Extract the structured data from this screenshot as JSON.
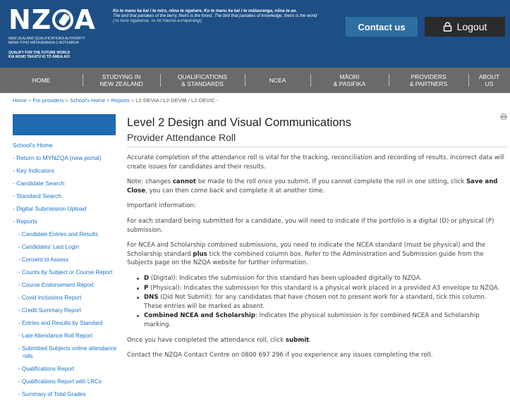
{
  "header": {
    "logo_text_pre": "NZ",
    "logo_text_post": "A",
    "logo_sub_1": "NEW ZEALAND QUALIFICATIONS AUTHORITY",
    "logo_sub_2": "MANA TOHU MĀTAURANGA O AOTEAROA",
    "logo_tag_1": "QUALIFY FOR THE FUTURE WORLD",
    "logo_tag_2": "KIA NOHO TAKATŪ KI TŌ ĀMUA AO!",
    "motto_line1": "Ko te manu ka kai i te miro, nōna te ngahere. Ko te manu ka kai i te mātauranga, nōna te ao.",
    "motto_line2": "The bird that partakes of the berry, theirs is the forest. The bird that partakes of knowledge, theirs is the world",
    "motto_line3": "(Te Kere Ngatierua, Te Ati Haunui-a-Pāpārangi)",
    "contact_label": "Contact us",
    "logout_label": "Logout"
  },
  "nav": {
    "home": "HOME",
    "studying_1": "STUDYING IN",
    "studying_2": "NEW ZEALAND",
    "quals_1": "QUALIFICATIONS",
    "quals_2": "& STANDARDS",
    "ncea": "NCEA",
    "maori_1": "MĀORI",
    "maori_2": "& PASIFIKA",
    "providers_1": "PROVIDERS",
    "providers_2": "& PARTNERS",
    "about_1": "ABOUT",
    "about_2": "US"
  },
  "breadcrumb": {
    "home": "Home",
    "providers": "For providers",
    "school_home": "School's Home",
    "reports": "Reports",
    "current": "L2-DEVIA / L2-DEVIB / L2-DEVIC -"
  },
  "sidebar": {
    "items": [
      "School's Home",
      "- Return to MYNZQA (new portal)",
      "- Key Indicators",
      "- Candidate Search",
      "- Standard Search",
      "- Digital Submission Upload",
      "- Reports",
      "- Candidate Entries and Results",
      "- Candidates' Last Login",
      "- Consent to Assess",
      "- Counts by Subject or Course Report",
      "- Course Endorsement Report",
      "- Covid Inclusions Report",
      "- Credit Summary Report",
      "- Entries and Results by Standard",
      "- Late Attendance Roll Report",
      "- Submitted Subjects online attendance rolls",
      "- Qualifications Report",
      "- Qualifications Report with LRCs",
      "- Summary of Total Grades"
    ]
  },
  "main": {
    "title": "Level 2 Design and Visual Communications",
    "subtitle": "Provider Attendance Roll",
    "p1": "Accurate completion of the attendance roll is vital for the tracking, reconciliation and recording of results. Incorrect data will create issues for candidates and their results.",
    "p2_a": "Note: changes ",
    "p2_b": "cannot",
    "p2_c": " be made to the roll once you submit. If you cannot complete the roll in one sitting, click ",
    "p2_d": "Save and Close",
    "p2_e": ", you can then come back and complete it at another time.",
    "p3": "Important information:",
    "p4": "For each standard being submitted for a candidate, you will need to indicate if the portfolio is a digital (D) or physical (P) submission.",
    "p5_a": "For NCEA and Scholarship combined submissions, you need to indicate the NCEA standard (must be physical) and the Scholarship standard ",
    "p5_b": "plus",
    "p5_c": " tick the combined column box. Refer to the Administration and Submission guide from the Subjects page on the NZQA website for further information.",
    "b1_t": "D",
    "b1_d": " (Digital): Indicates the submission for this standard has been uploaded digitally to NZQA.",
    "b2_t": "P",
    "b2_d": " (Physical): Indicates the submission for this standard is a physical work placed in a provided A3 envelope to NZQA.",
    "b3_t": "DNS",
    "b3_d": " (Did Not Submit): for any candidates that have chosen not to present work for a standard, tick this column. These entries will be marked as absent.",
    "b4_t": "Combined NCEA and Scholarship",
    "b4_d": ": Indicates the physical submission is for combined NCEA and Scholarship marking.",
    "p6_a": "Once you have completed the attendance roll, click ",
    "p6_b": "submit",
    "p6_c": ".",
    "p7": "Contact the NZQA Contact Centre on 0800 697 296 if you experience any issues completing the roll."
  },
  "colors": {
    "header_bg": "#1d4f85",
    "nav_bg": "#6a6a6a",
    "link": "#1a73c9",
    "contact_bg": "#2e6ea3",
    "logout_bg": "#2b2b2b"
  }
}
